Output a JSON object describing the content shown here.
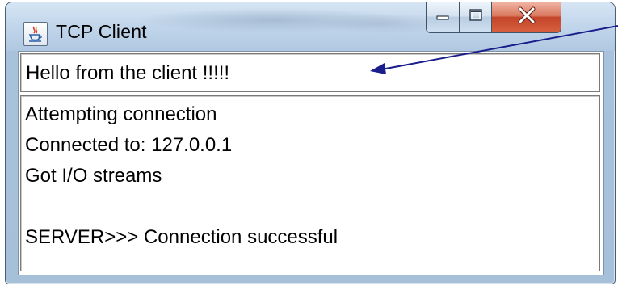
{
  "window": {
    "title": "TCP Client",
    "icon": "java-cup-icon",
    "controls": [
      "minimize-icon",
      "maximize-icon",
      "close-icon"
    ]
  },
  "enter_field": {
    "value": "Hello from the client !!!!!"
  },
  "display_area": {
    "lines": [
      "Attempting connection",
      "Connected to: 127.0.0.1",
      "Got I/O streams",
      "",
      "SERVER>>> Connection successful"
    ]
  },
  "annotation": {
    "icon": "arrow-icon",
    "color": "#1a1e8c"
  }
}
